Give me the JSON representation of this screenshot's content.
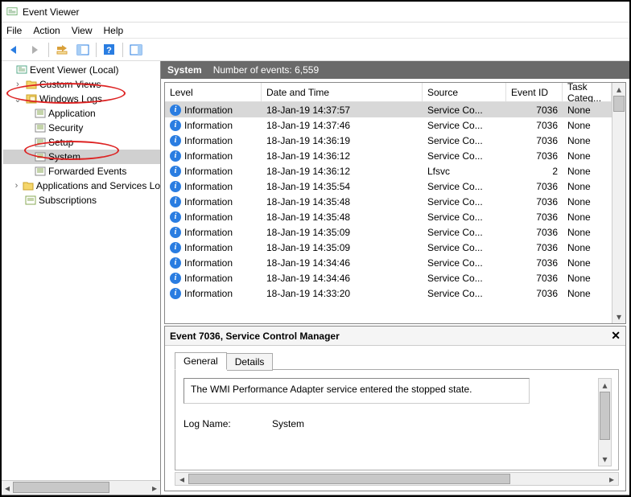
{
  "window": {
    "title": "Event Viewer"
  },
  "menu": {
    "file": "File",
    "action": "Action",
    "view": "View",
    "help": "Help"
  },
  "tree": {
    "root": "Event Viewer (Local)",
    "custom_views": "Custom Views",
    "windows_logs": "Windows Logs",
    "application": "Application",
    "security": "Security",
    "setup": "Setup",
    "system": "System",
    "forwarded": "Forwarded Events",
    "apps_services": "Applications and Services Lo",
    "subscriptions": "Subscriptions"
  },
  "header": {
    "log_name": "System",
    "count_label": "Number of events: 6,559"
  },
  "columns": {
    "level": "Level",
    "date": "Date and Time",
    "source": "Source",
    "event_id": "Event ID",
    "category": "Task Categ..."
  },
  "rows": [
    {
      "level": "Information",
      "date": "18-Jan-19 14:37:57",
      "source": "Service Co...",
      "id": "7036",
      "cat": "None",
      "sel": true
    },
    {
      "level": "Information",
      "date": "18-Jan-19 14:37:46",
      "source": "Service Co...",
      "id": "7036",
      "cat": "None"
    },
    {
      "level": "Information",
      "date": "18-Jan-19 14:36:19",
      "source": "Service Co...",
      "id": "7036",
      "cat": "None"
    },
    {
      "level": "Information",
      "date": "18-Jan-19 14:36:12",
      "source": "Service Co...",
      "id": "7036",
      "cat": "None"
    },
    {
      "level": "Information",
      "date": "18-Jan-19 14:36:12",
      "source": "Lfsvc",
      "id": "2",
      "cat": "None"
    },
    {
      "level": "Information",
      "date": "18-Jan-19 14:35:54",
      "source": "Service Co...",
      "id": "7036",
      "cat": "None"
    },
    {
      "level": "Information",
      "date": "18-Jan-19 14:35:48",
      "source": "Service Co...",
      "id": "7036",
      "cat": "None"
    },
    {
      "level": "Information",
      "date": "18-Jan-19 14:35:48",
      "source": "Service Co...",
      "id": "7036",
      "cat": "None"
    },
    {
      "level": "Information",
      "date": "18-Jan-19 14:35:09",
      "source": "Service Co...",
      "id": "7036",
      "cat": "None"
    },
    {
      "level": "Information",
      "date": "18-Jan-19 14:35:09",
      "source": "Service Co...",
      "id": "7036",
      "cat": "None"
    },
    {
      "level": "Information",
      "date": "18-Jan-19 14:34:46",
      "source": "Service Co...",
      "id": "7036",
      "cat": "None"
    },
    {
      "level": "Information",
      "date": "18-Jan-19 14:34:46",
      "source": "Service Co...",
      "id": "7036",
      "cat": "None"
    },
    {
      "level": "Information",
      "date": "18-Jan-19 14:33:20",
      "source": "Service Co...",
      "id": "7036",
      "cat": "None"
    }
  ],
  "detail": {
    "title": "Event 7036, Service Control Manager",
    "tab_general": "General",
    "tab_details": "Details",
    "message": "The WMI Performance Adapter service entered the stopped state.",
    "logname_k": "Log Name:",
    "logname_v": "System"
  }
}
